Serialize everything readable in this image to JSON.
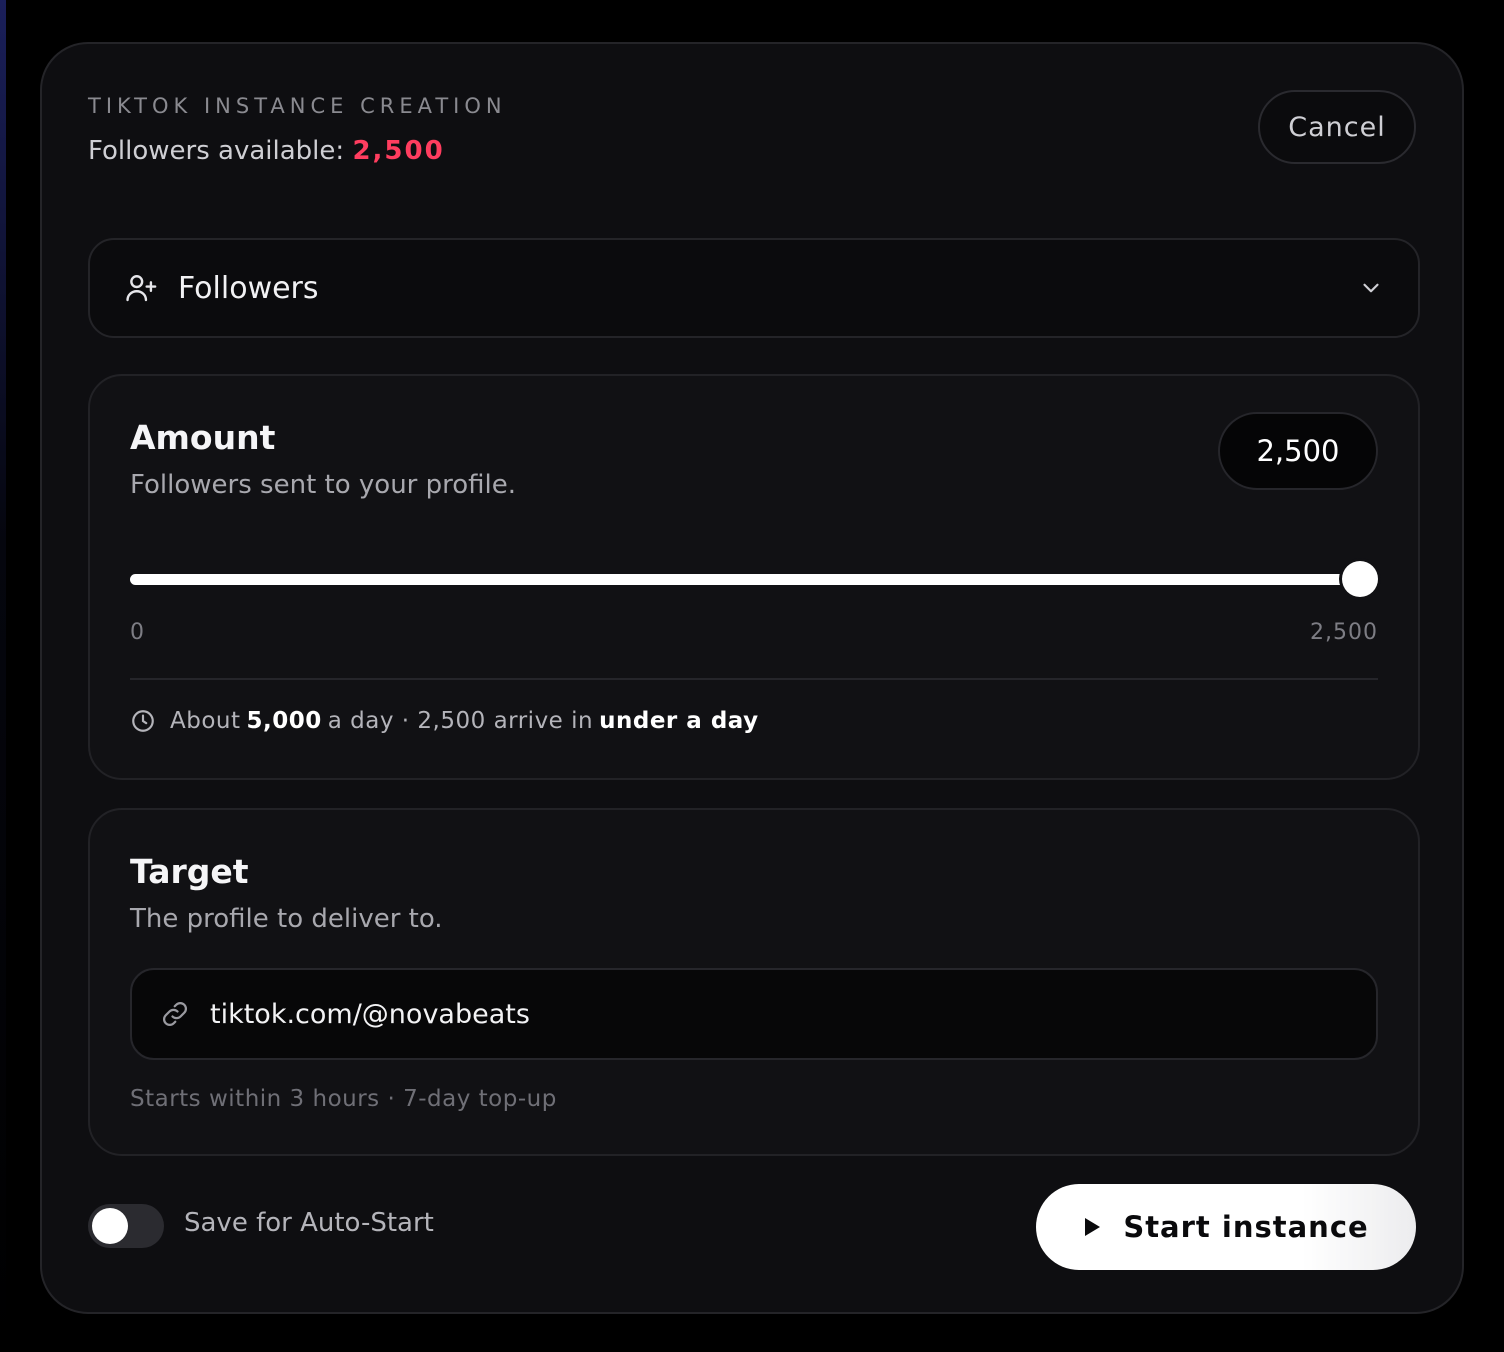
{
  "header": {
    "kicker": "TIKTOK INSTANCE CREATION",
    "available_label": "Followers available: ",
    "available_value": "2,500",
    "cancel_label": "Cancel"
  },
  "service_select": {
    "icon": "user-plus-icon",
    "selected": "Followers"
  },
  "amount": {
    "title": "Amount",
    "subtitle": "Followers sent to your profile.",
    "value": "2,500",
    "slider": {
      "min_label": "0",
      "max_label": "2,500",
      "min": 0,
      "max": 2500,
      "value": 2500
    },
    "eta": {
      "prefix": "About",
      "rate": "5,000",
      "middle": "a day · 2,500 arrive in",
      "duration": "under a day"
    }
  },
  "target": {
    "title": "Target",
    "subtitle": "The profile to deliver to.",
    "url_value": "tiktok.com/@novabeats",
    "note": "Starts within 3 hours · 7-day top-up"
  },
  "footer": {
    "toggle_label": "Save for Auto-Start",
    "toggle_on": false,
    "start_label": "Start instance"
  },
  "colors": {
    "accent": "#ff3d5f",
    "background": "#000000",
    "modal": "#0e0e11"
  }
}
